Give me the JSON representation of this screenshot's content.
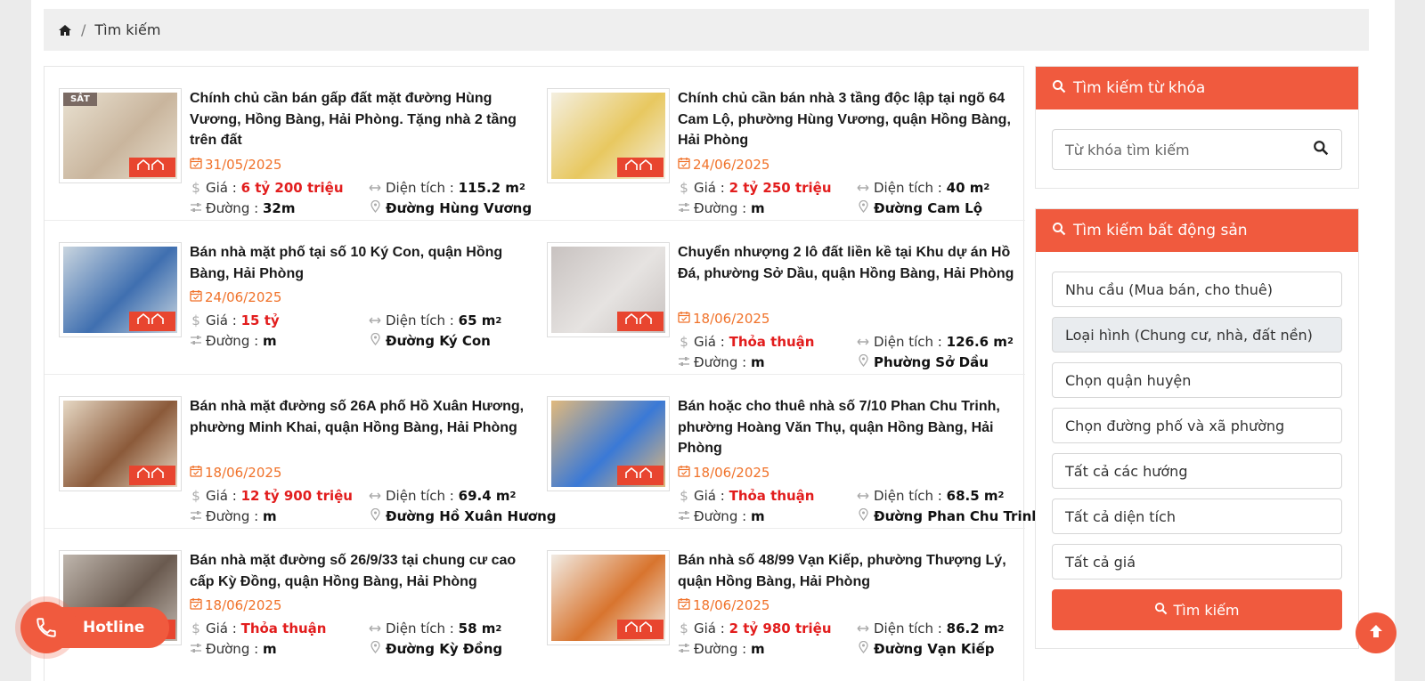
{
  "breadcrumb": {
    "home_icon": "home-icon",
    "current": "Tìm kiếm"
  },
  "listings": [
    {
      "title": "Chính chủ cần bán gấp đất mặt đường Hùng Vương, Hồng Bàng, Hải Phòng. Tặng nhà 2 tầng trên đất",
      "date": "31/05/2025",
      "price_label": "Giá :",
      "price": "6 tỷ 200 triệu",
      "area_label": "Diện tích :",
      "area": "115.2 m",
      "area_unit_sup": "2",
      "road_label": "Đường :",
      "road": "32m",
      "street": "Đường Hùng Vương",
      "badge": "SẮT",
      "thumb_colors": [
        "#c9b59d",
        "#e9e1d1"
      ]
    },
    {
      "title": "Chính chủ cần bán nhà 3 tầng độc lập tại ngõ 64 Cam Lộ, phường Hùng Vương, quận Hồng Bàng, Hải Phòng",
      "date": "24/06/2025",
      "price_label": "Giá :",
      "price": "2 tỷ 250 triệu",
      "area_label": "Diện tích :",
      "area": "40 m",
      "area_unit_sup": "2",
      "road_label": "Đường :",
      "road": "m",
      "street": "Đường Cam Lộ",
      "thumb_colors": [
        "#e8c860",
        "#f4efe0"
      ]
    },
    {
      "title": "Bán nhà mặt phố tại số 10 Ký Con, quận Hồng Bàng, Hải Phòng",
      "date": "24/06/2025",
      "price_label": "Giá :",
      "price": "15 tỷ",
      "area_label": "Diện tích :",
      "area": "65 m",
      "area_unit_sup": "2",
      "road_label": "Đường :",
      "road": "m",
      "street": "Đường Ký Con",
      "thumb_colors": [
        "#3f6fb0",
        "#c9d5df"
      ]
    },
    {
      "title": "Chuyển nhượng 2 lô đất liền kề tại Khu dự án Hồ Đá, phường Sở Dầu, quận Hồng Bàng, Hải Phòng",
      "date": "18/06/2025",
      "price_label": "Giá :",
      "price": "Thỏa thuận",
      "area_label": "Diện tích :",
      "area": "126.6 m",
      "area_unit_sup": "2",
      "road_label": "Đường :",
      "road": "m",
      "street": "Phường Sở Dầu",
      "thumb_colors": [
        "#e6e3e1",
        "#c8c2c0"
      ]
    },
    {
      "title": "Bán nhà mặt đường số 26A phố Hồ Xuân Hương, phường Minh Khai, quận Hồng Bàng, Hải Phòng",
      "date": "18/06/2025",
      "price_label": "Giá :",
      "price": "12 tỷ 900 triệu",
      "area_label": "Diện tích :",
      "area": "69.4 m",
      "area_unit_sup": "2",
      "road_label": "Đường :",
      "road": "m",
      "street": "Đường Hồ Xuân Hương",
      "thumb_colors": [
        "#8b5a3a",
        "#e6d8c4"
      ]
    },
    {
      "title": "Bán hoặc cho thuê nhà số 7/10 Phan Chu Trinh, phường Hoàng Văn Thụ, quận Hồng Bàng, Hải Phòng",
      "date": "18/06/2025",
      "price_label": "Giá :",
      "price": "Thỏa thuận",
      "area_label": "Diện tích :",
      "area": "68.5 m",
      "area_unit_sup": "2",
      "road_label": "Đường :",
      "road": "m",
      "street": "Đường Phan Chu Trinh",
      "thumb_colors": [
        "#3a79d6",
        "#e1b97c"
      ]
    },
    {
      "title": "Bán nhà mặt đường số 26/9/33 tại chung cư cao cấp Kỳ Đồng, quận Hồng Bàng, Hải Phòng",
      "date": "18/06/2025",
      "price_label": "Giá :",
      "price": "Thỏa thuận",
      "area_label": "Diện tích :",
      "area": "58 m",
      "area_unit_sup": "2",
      "road_label": "Đường :",
      "road": "m",
      "street": "Đường Kỳ Đồng",
      "thumb_colors": [
        "#6a5a4f",
        "#bfb6ad"
      ]
    },
    {
      "title": "Bán nhà số 48/99 Vạn Kiếp, phường Thượng Lý, quận Hồng Bàng, Hải Phòng",
      "date": "18/06/2025",
      "price_label": "Giá :",
      "price": "2 tỷ 980 triệu",
      "area_label": "Diện tích :",
      "area": "86.2 m",
      "area_unit_sup": "2",
      "road_label": "Đường :",
      "road": "m",
      "street": "Đường Vạn Kiếp",
      "thumb_colors": [
        "#d8742e",
        "#f1ebe3"
      ]
    }
  ],
  "sidebar": {
    "keyword_box": {
      "title": "Tìm kiếm từ khóa",
      "placeholder": "Từ khóa tìm kiếm"
    },
    "property_box": {
      "title": "Tìm kiếm bất động sản",
      "fields": [
        "Nhu cầu (Mua bán, cho thuê)",
        "Loại hình (Chung cư, nhà, đất nền)",
        "Chọn quận huyện",
        "Chọn đường phố và xã phường",
        "Tất cả các hướng",
        "Tất cả diện tích",
        "Tất cả giá"
      ],
      "submit": "Tìm kiếm"
    }
  },
  "hotline": {
    "label": "Hotline"
  },
  "colors": {
    "accent": "#f05a3e",
    "price": "#e21d1d",
    "date": "#f0722a"
  },
  "icons": [
    "home-icon",
    "search-icon",
    "calendar-icon",
    "dollar-icon",
    "arrows-horizontal-icon",
    "sliders-icon",
    "map-pin-icon",
    "phone-icon",
    "arrow-up-icon"
  ]
}
